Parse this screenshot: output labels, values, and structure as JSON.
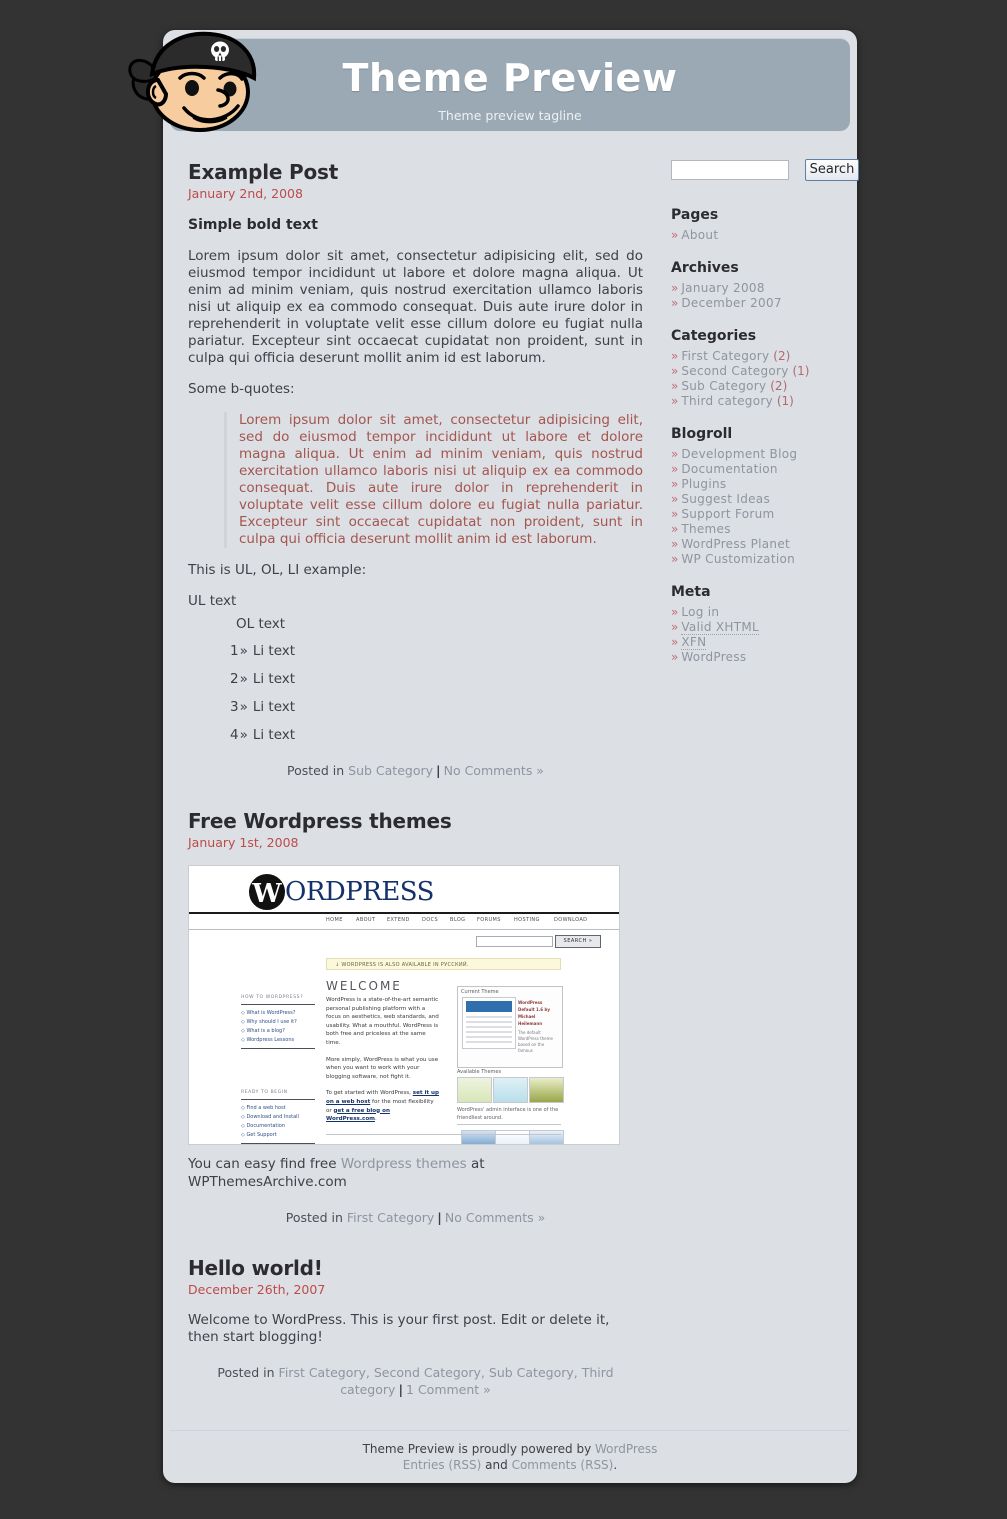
{
  "site": {
    "title": "Theme Preview",
    "tagline": "Theme preview tagline",
    "logo_icon": "pirate-head-icon"
  },
  "search": {
    "value": "",
    "placeholder": "",
    "button_label": "Search"
  },
  "posts": [
    {
      "title": "Example Post",
      "date": "January 2nd, 2008",
      "bold_text": "Simple bold text",
      "paragraph": "Lorem ipsum dolor sit amet, consectetur adipisicing elit, sed do eiusmod tempor incididunt ut labore et dolore magna aliqua. Ut enim ad minim veniam, quis nostrud exercitation ullamco laboris nisi ut aliquip ex ea commodo consequat. Duis aute irure dolor in reprehenderit in voluptate velit esse cillum dolore eu fugiat nulla pariatur. Excepteur sint occaecat cupidatat non proident, sunt in culpa qui officia deserunt mollit anim id est laborum.",
      "quote_intro": "Some b-quotes:",
      "blockquote": "Lorem ipsum dolor sit amet, consectetur adipisicing elit, sed do eiusmod tempor incididunt ut labore et dolore magna aliqua. Ut enim ad minim veniam, quis nostrud exercitation ullamco laboris nisi ut aliquip ex ea commodo consequat. Duis aute irure dolor in reprehenderit in voluptate velit esse cillum dolore eu fugiat nulla pariatur. Excepteur sint occaecat cupidatat non proident, sunt in culpa qui officia deserunt mollit anim id est laborum.",
      "list_intro": "This is UL, OL, LI example:",
      "ul_text": "UL text",
      "ol_text": "OL text",
      "li_items": [
        {
          "num": "1",
          "raq": "»",
          "text": "Li text"
        },
        {
          "num": "2",
          "raq": "»",
          "text": "Li text"
        },
        {
          "num": "3",
          "raq": "»",
          "text": "Li text"
        },
        {
          "num": "4",
          "raq": "»",
          "text": "Li text"
        }
      ],
      "meta_prefix": "Posted in",
      "meta_categories": "Sub Category",
      "meta_sep": "|",
      "meta_comments": "No Comments »"
    },
    {
      "title": "Free Wordpress themes",
      "date": "January 1st, 2008",
      "caption_before": "You can easy find free ",
      "caption_link": "Wordpress themes",
      "caption_after": " at WPThemesArchive.com",
      "meta_prefix": "Posted in",
      "meta_categories": "First Category",
      "meta_sep": "|",
      "meta_comments": "No Comments »"
    },
    {
      "title": "Hello world!",
      "date": "December 26th, 2007",
      "paragraph": "Welcome to WordPress. This is your first post. Edit or delete it, then start blogging!",
      "meta_prefix": "Posted in",
      "meta_categories": "First Category, Second Category, Sub Category, Third category",
      "meta_sep": "|",
      "meta_comments": "1 Comment »"
    }
  ],
  "screenshot": {
    "brand_mark": "W",
    "brand_name": "ORD",
    "brand_name2": "RESS",
    "brand_p": "P",
    "nav": [
      "HOME",
      "ABOUT",
      "EXTEND",
      "DOCS",
      "BLOG",
      "FORUMS",
      "HOSTING",
      "DOWNLOAD"
    ],
    "search_button": "SEARCH »",
    "notice": "↓ WORDPRESS IS ALSO AVAILABLE IN РУССКИЙ.",
    "welcome": "WELCOME",
    "left_heading": "HOW TO WORDPRESS?",
    "left_links": [
      "What is WordPress?",
      "Why should I use it?",
      "What is a blog?",
      "Wordpress Lessons"
    ],
    "left_heading2": "READY TO BEGIN",
    "left_links2": [
      "Find a web host",
      "Download and Install",
      "Documentation",
      "Get Support"
    ],
    "body_1": "WordPress is a state-of-the-art semantic personal publishing platform with a focus on aesthetics, web standards, and usability. What a mouthful. WordPress is both free and priceless at the same time.",
    "body_2": "More simply, WordPress is what you use when you want to work with your blogging software, not fight it.",
    "body_3a": "To get started with WordPress, ",
    "body_3b": "set it up on a web host",
    "body_3c": " for the most flexibility or ",
    "body_3d": "get a free blog on WordPress.com",
    "body_3e": ".",
    "panel_title": "Current Theme",
    "panel_side_title": "WordPress Default 1.6 by Michael Heilemann",
    "panel_side_text": "The default WordPress theme based on the famous",
    "available_themes": "Available Themes",
    "panel_caption": "WordPress' admin interface is one of the friendliest around."
  },
  "sidebar": {
    "sections": [
      {
        "heading": "Pages",
        "items": [
          {
            "label": "About",
            "count": ""
          }
        ]
      },
      {
        "heading": "Archives",
        "items": [
          {
            "label": "January 2008",
            "count": ""
          },
          {
            "label": "December 2007",
            "count": ""
          }
        ]
      },
      {
        "heading": "Categories",
        "items": [
          {
            "label": "First Category",
            "count": "(2)"
          },
          {
            "label": "Second Category",
            "count": "(1)"
          },
          {
            "label": "Sub Category",
            "count": "(2)"
          },
          {
            "label": "Third category",
            "count": "(1)"
          }
        ]
      },
      {
        "heading": "Blogroll",
        "items": [
          {
            "label": "Development Blog",
            "count": ""
          },
          {
            "label": "Documentation",
            "count": ""
          },
          {
            "label": "Plugins",
            "count": ""
          },
          {
            "label": "Suggest Ideas",
            "count": ""
          },
          {
            "label": "Support Forum",
            "count": ""
          },
          {
            "label": "Themes",
            "count": ""
          },
          {
            "label": "WordPress Planet",
            "count": ""
          },
          {
            "label": "WP Customization",
            "count": ""
          }
        ]
      },
      {
        "heading": "Meta",
        "items": [
          {
            "label": "Log in",
            "count": ""
          },
          {
            "label": "Valid XHTML",
            "count": "",
            "abbr": "XHTML"
          },
          {
            "label": "XFN",
            "count": "",
            "abbr": "XFN"
          },
          {
            "label": "WordPress",
            "count": ""
          }
        ]
      }
    ],
    "bullet": "»"
  },
  "footer": {
    "line1_before": "Theme Preview is proudly powered by ",
    "line1_link": "WordPress",
    "line2_link1": "Entries (RSS)",
    "line2_and": " and ",
    "line2_link2": "Comments (RSS)",
    "line2_end": "."
  },
  "colors": {
    "backdrop": "#333333",
    "page": "#dcdfe4",
    "header": "#9aa9b4",
    "date": "#bd4b4b",
    "quote": "#a4564f",
    "link": "#8e959f",
    "bullet": "#c0707a"
  }
}
